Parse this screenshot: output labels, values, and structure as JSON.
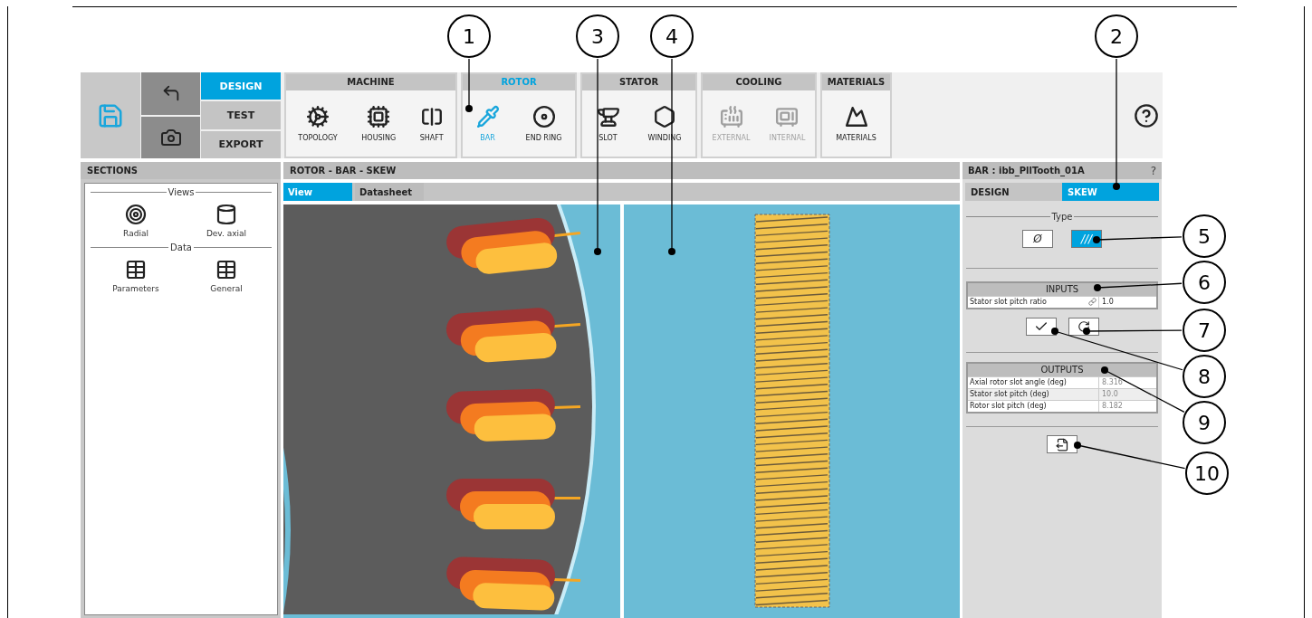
{
  "toolbar": {
    "modes": [
      {
        "label": "DESIGN",
        "selected": true
      },
      {
        "label": "TEST",
        "selected": false
      },
      {
        "label": "EXPORT",
        "selected": false
      }
    ],
    "groups": [
      {
        "title": "MACHINE",
        "selected": false,
        "items": [
          {
            "label": "TOPOLOGY",
            "selected": false,
            "disabled": false
          },
          {
            "label": "HOUSING",
            "selected": false,
            "disabled": false
          },
          {
            "label": "SHAFT",
            "selected": false,
            "disabled": false
          }
        ]
      },
      {
        "title": "ROTOR",
        "selected": true,
        "items": [
          {
            "label": "BAR",
            "selected": true,
            "disabled": false
          },
          {
            "label": "END RING",
            "selected": false,
            "disabled": false
          }
        ]
      },
      {
        "title": "STATOR",
        "selected": false,
        "items": [
          {
            "label": "SLOT",
            "selected": false,
            "disabled": false
          },
          {
            "label": "WINDING",
            "selected": false,
            "disabled": false
          }
        ]
      },
      {
        "title": "COOLING",
        "selected": false,
        "items": [
          {
            "label": "EXTERNAL",
            "selected": false,
            "disabled": true
          },
          {
            "label": "INTERNAL",
            "selected": false,
            "disabled": true
          }
        ]
      },
      {
        "title": "MATERIALS",
        "selected": false,
        "items": [
          {
            "label": "MATERIALS",
            "selected": false,
            "disabled": false
          }
        ]
      }
    ]
  },
  "sections": {
    "title": "SECTIONS",
    "groups": [
      {
        "title": "Views",
        "items": [
          {
            "label": "Radial"
          },
          {
            "label": "Dev. axial"
          }
        ]
      },
      {
        "title": "Data",
        "items": [
          {
            "label": "Parameters"
          },
          {
            "label": "General"
          }
        ]
      }
    ]
  },
  "view": {
    "title": "ROTOR - BAR - SKEW",
    "tabs": [
      {
        "label": "View",
        "selected": true
      },
      {
        "label": "Datasheet",
        "selected": false
      }
    ]
  },
  "panel": {
    "title": "BAR : ibb_PllTooth_01A",
    "help": "?",
    "tabs": [
      {
        "label": "DESIGN",
        "selected": false
      },
      {
        "label": "SKEW",
        "selected": true
      }
    ],
    "type_title": "Type",
    "types": [
      {
        "label": "Ø",
        "selected": false
      },
      {
        "label": "///",
        "selected": true
      }
    ],
    "inputs": {
      "title": "INPUTS",
      "rows": [
        {
          "label": "Stator slot pitch ratio",
          "value": "1.0"
        }
      ]
    },
    "outputs": {
      "title": "OUTPUTS",
      "rows": [
        {
          "label": "Axial rotor slot angle (deg)",
          "value": "8.316"
        },
        {
          "label": "Stator slot pitch (deg)",
          "value": "10.0"
        },
        {
          "label": "Rotor slot pitch (deg)",
          "value": "8.182"
        }
      ]
    }
  },
  "callouts": [
    "1",
    "3",
    "4",
    "2",
    "5",
    "6",
    "7",
    "8",
    "9",
    "10"
  ]
}
